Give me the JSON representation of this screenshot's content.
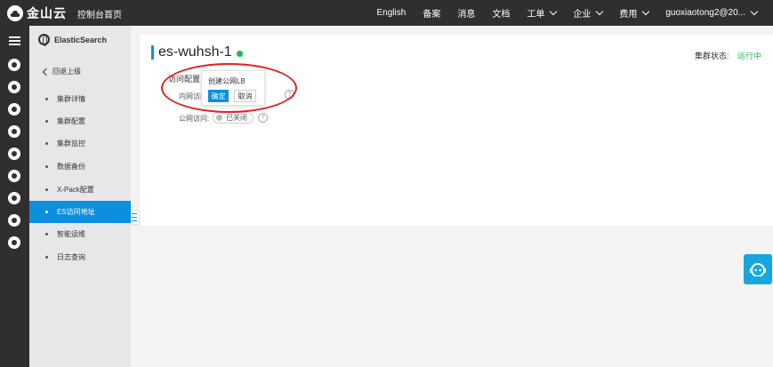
{
  "topbar": {
    "logo_text": "金山云",
    "home_link": "控制台首页",
    "nav": [
      {
        "label": "English",
        "dropdown": false
      },
      {
        "label": "备案",
        "dropdown": false
      },
      {
        "label": "消息",
        "dropdown": false
      },
      {
        "label": "文档",
        "dropdown": false
      },
      {
        "label": "工单",
        "dropdown": true
      },
      {
        "label": "企业",
        "dropdown": true
      },
      {
        "label": "费用",
        "dropdown": true
      },
      {
        "label": "guoxiaotong2@20...",
        "dropdown": true
      }
    ]
  },
  "sidebar": {
    "title": "ElasticSearch",
    "back_label": "回退上级",
    "items": [
      {
        "label": "集群详情",
        "active": false
      },
      {
        "label": "集群配置",
        "active": false
      },
      {
        "label": "集群监控",
        "active": false
      },
      {
        "label": "数据备份",
        "active": false
      },
      {
        "label": "X-Pack配置",
        "active": false
      },
      {
        "label": "ES访问地址",
        "active": true
      },
      {
        "label": "智能运维",
        "active": false
      },
      {
        "label": "日志查询",
        "active": false
      }
    ]
  },
  "main": {
    "cluster_name": "es-wuhsh-1",
    "cluster_status_label": "集群状态:",
    "cluster_status_value": "运行中",
    "access_config_label": "访问配置",
    "inner_access_label": "内网访问",
    "public_access_label": "公网访问:",
    "public_access_toggle": "已关闭",
    "help_glyph": "?"
  },
  "popover": {
    "text": "创建公网LB",
    "ok_label": "确定",
    "cancel_label": "取消"
  },
  "colors": {
    "accent": "#0d8fe0",
    "status_running": "#1fba4f",
    "annotation": "#e32020",
    "topbar": "#2f2f2f"
  }
}
